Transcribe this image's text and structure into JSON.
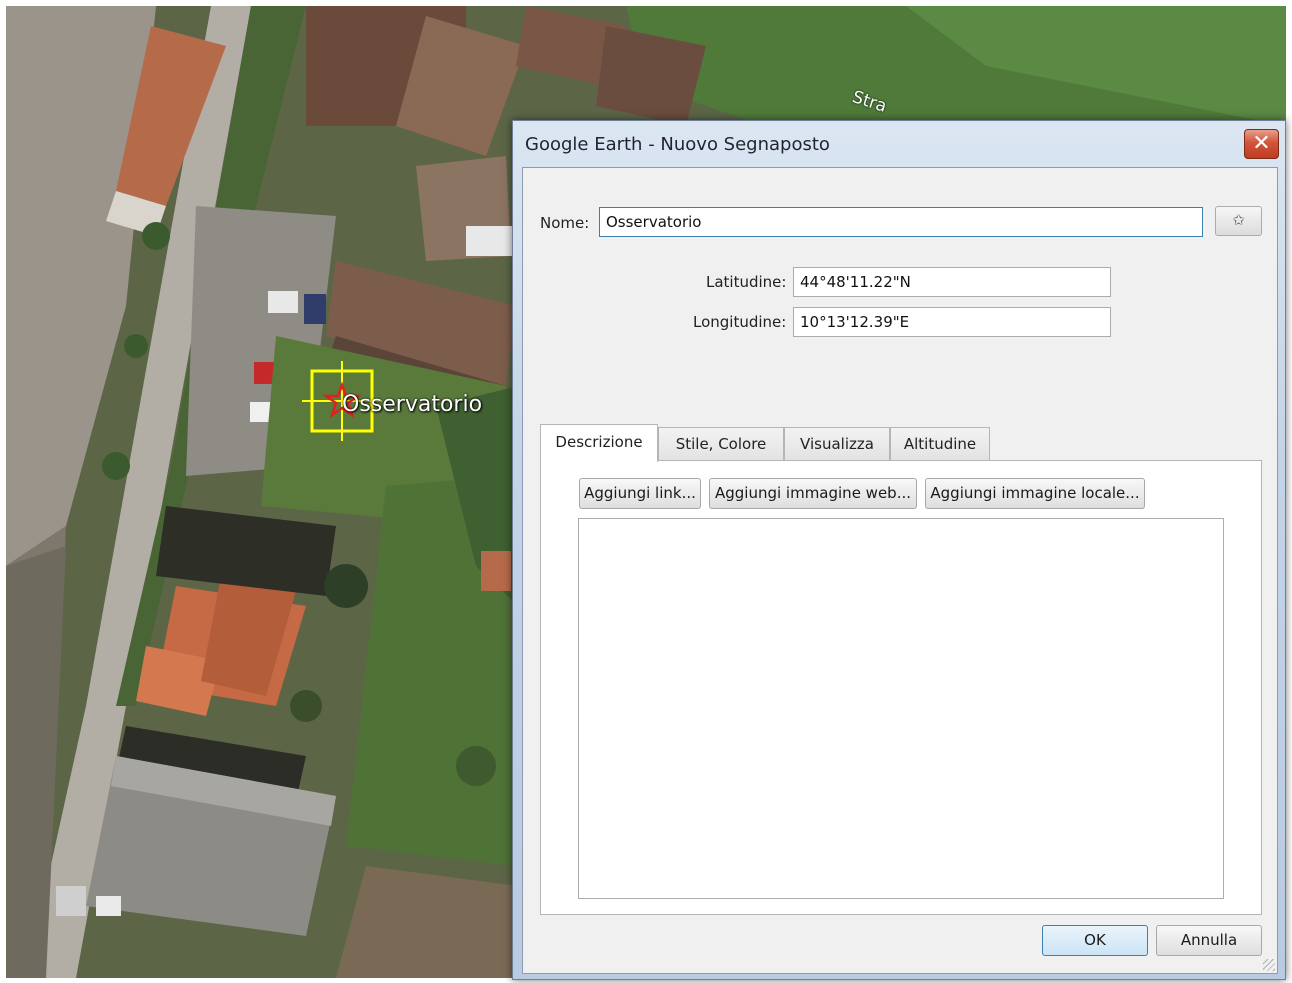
{
  "map": {
    "placemark_label": "Osservatorio",
    "road_label": "Stra"
  },
  "dialog": {
    "title": "Google Earth - Nuovo Segnaposto",
    "close_glyph": "✕",
    "name_label": "Nome:",
    "name_value": "Osservatorio",
    "icon_button_glyph": "✩",
    "latitude_label": "Latitudine:",
    "latitude_value": "44°48'11.22\"N",
    "longitude_label": "Longitudine:",
    "longitude_value": "10°13'12.39\"E",
    "tabs": [
      {
        "label": "Descrizione",
        "active": true
      },
      {
        "label": "Stile, Colore",
        "active": false
      },
      {
        "label": "Visualizza",
        "active": false
      },
      {
        "label": "Altitudine",
        "active": false
      }
    ],
    "description_buttons": {
      "add_link": "Aggiungi link...",
      "add_web_image": "Aggiungi immagine web...",
      "add_local_image": "Aggiungi immagine locale..."
    },
    "description_text": "",
    "ok_label": "OK",
    "cancel_label": "Annulla"
  },
  "colors": {
    "close_button": "#c9432a",
    "selection_box": "#ffff00",
    "placemark_star": "#e02020",
    "focus_border": "#3c7fb1"
  }
}
